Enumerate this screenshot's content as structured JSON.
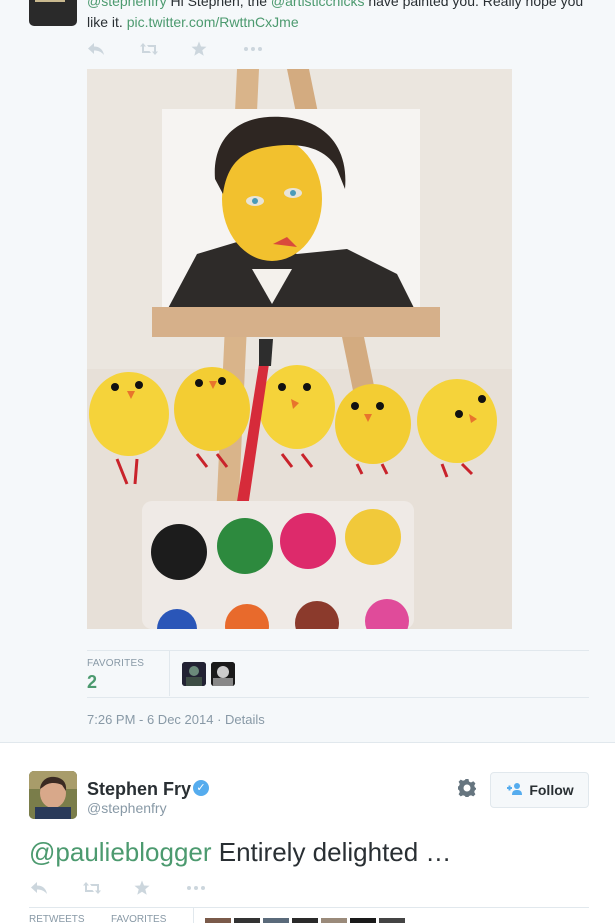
{
  "top_tweet": {
    "text_prefix_mention": "@stephenfry",
    "text_before_mention2": " Hi Stephen, the ",
    "mention2": "@artisticchicks",
    "text_after_mention2": " have painted you. Really hope you",
    "text_line2": "like it. ",
    "link": "pic.twitter.com/RwttnCxJme",
    "actions": [
      "reply-icon",
      "retweet-icon",
      "favorite-icon",
      "more-icon"
    ],
    "favorites_label": "FAVORITES",
    "favorites_count": "2",
    "timestamp": "7:26 PM - 6 Dec 2014",
    "details_sep": " · ",
    "details_label": "Details"
  },
  "bottom_tweet": {
    "name": "Stephen Fry",
    "verified": "✓",
    "handle": "@stephenfry",
    "follow_label": "Follow",
    "mention": "@paulieblogger",
    "text": " Entirely delighted …",
    "retweets_label": "RETWEETS",
    "favorites_label": "FAVORITES"
  },
  "colors": {
    "background": "#f5f8fa",
    "mention_green": "#4c9a6f",
    "muted": "#8899a6",
    "verified_blue": "#55acee"
  }
}
